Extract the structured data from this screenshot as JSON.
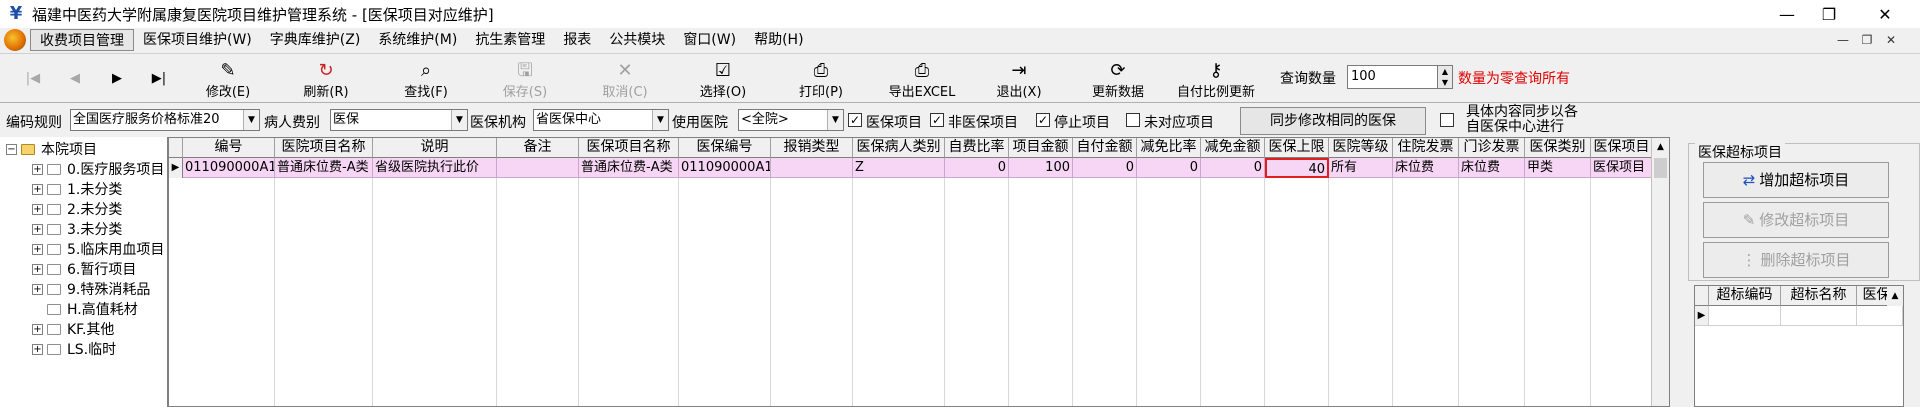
{
  "window": {
    "title": "福建中医药大学附属康复医院项目维护管理系统 - [医保项目对应维护]",
    "minimize": "—",
    "maximize": "❐",
    "close": "✕"
  },
  "menu": {
    "items": [
      "收费项目管理",
      "医保项目维护(W)",
      "字典库维护(Z)",
      "系统维护(M)",
      "抗生素管理",
      "报表",
      "公共模块",
      "窗口(W)",
      "帮助(H)"
    ],
    "mdi": [
      "—",
      "❐",
      "✕"
    ]
  },
  "toolbar": {
    "nav": [
      "|◀",
      "◀",
      "▶",
      "▶|"
    ],
    "buttons": [
      {
        "label": "修改(E)",
        "icon": "edit-icon",
        "glyph": "✎",
        "enabled": true
      },
      {
        "label": "刷新(R)",
        "icon": "refresh-icon",
        "glyph": "↻",
        "enabled": true
      },
      {
        "label": "查找(F)",
        "icon": "binoculars-icon",
        "glyph": "⌕",
        "enabled": true
      },
      {
        "label": "保存(S)",
        "icon": "save-icon",
        "glyph": "🖫",
        "enabled": false
      },
      {
        "label": "取消(C)",
        "icon": "cancel-icon",
        "glyph": "✕",
        "enabled": false
      },
      {
        "label": "选择(O)",
        "icon": "select-icon",
        "glyph": "☑",
        "enabled": true
      },
      {
        "label": "打印(P)",
        "icon": "printer-icon",
        "glyph": "⎙",
        "enabled": true
      },
      {
        "label": "导出EXCEL",
        "icon": "export-icon",
        "glyph": "⎙",
        "enabled": true
      },
      {
        "label": "退出(X)",
        "icon": "exit-icon",
        "glyph": "⇥",
        "enabled": true
      },
      {
        "label": "更新数据",
        "icon": "update-icon",
        "glyph": "⟳",
        "enabled": true
      },
      {
        "label": "自付比例更新",
        "icon": "key-icon",
        "glyph": "⚷",
        "enabled": true
      }
    ],
    "query_label": "查询数量",
    "query_value": "100",
    "query_hint": "数量为零查询所有"
  },
  "filters": {
    "coding_rule_label": "编码规则",
    "coding_rule_value": "全国医疗服务价格标准20",
    "patient_type_label": "病人费别",
    "patient_type_value": "医保",
    "insurer_label": "医保机构",
    "insurer_value": "省医保中心",
    "hospital_label": "使用医院",
    "hospital_value": "<全院>",
    "checks": [
      {
        "label": "医保项目",
        "checked": true
      },
      {
        "label": "非医保项目",
        "checked": true
      },
      {
        "label": "停止项目",
        "checked": true
      },
      {
        "label": "未对应项目",
        "checked": false
      }
    ],
    "sync_button": "同步修改相同的医保",
    "sync_text_line1": "具体内容同步以各",
    "sync_text_line2": "自医保中心进行",
    "sync_checked": false
  },
  "tree": {
    "root": "本院项目",
    "items": [
      "0.医疗服务项目",
      "1.未分类",
      "2.未分类",
      "3.未分类",
      "5.临床用血项目",
      "6.暂行项目",
      "9.特殊消耗品",
      "H.高值耗材",
      "KF.其他",
      "LS.临时"
    ]
  },
  "grid": {
    "columns": [
      "编号",
      "医院项目名称",
      "说明",
      "备注",
      "医保项目名称",
      "医保编号",
      "报销类型",
      "医保病人类别",
      "自费比率",
      "项目金额",
      "自付金额",
      "减免比率",
      "减免金额",
      "医保上限",
      "医院等级",
      "住院发票",
      "门诊发票",
      "医保类别",
      "医保项目"
    ],
    "rows": [
      [
        "011090000A11",
        "普通床位费-A类",
        "省级医院执行此价",
        "",
        "普通床位费-A类",
        "011090000A11",
        "",
        "Z",
        "0",
        "100",
        "0",
        "0",
        "0",
        "40",
        "所有",
        "床位费",
        "床位费",
        "甲类",
        "医保项目"
      ]
    ]
  },
  "right_panel": {
    "group_title": "医保超标项目",
    "buttons": [
      {
        "label": "增加超标项目",
        "icon": "add-icon",
        "enabled": true
      },
      {
        "label": "修改超标项目",
        "icon": "edit-icon",
        "enabled": false
      },
      {
        "label": "删除超标项目",
        "icon": "delete-icon",
        "enabled": false
      }
    ],
    "subgrid_columns": [
      "超标编码",
      "超标名称",
      "医保"
    ]
  }
}
